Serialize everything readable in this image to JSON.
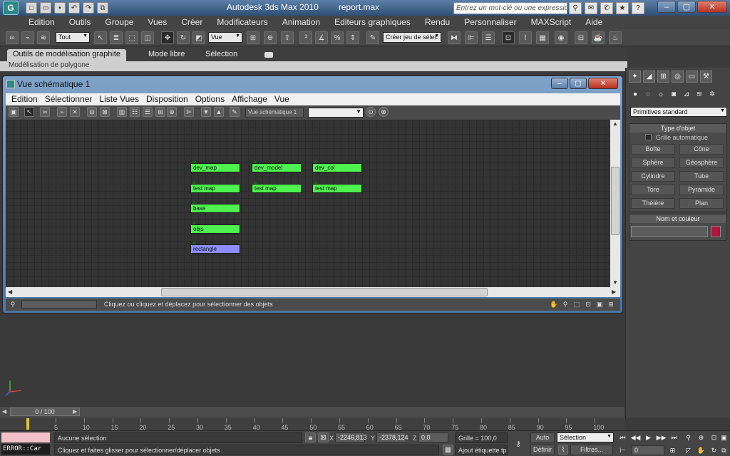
{
  "app": {
    "title": "Autodesk 3ds Max  2010",
    "file": "report.max",
    "icon_letter": "G",
    "search_placeholder": "Entrez un mot-clé ou une expression"
  },
  "menu": [
    "Edition",
    "Outils",
    "Groupe",
    "Vues",
    "Créer",
    "Modificateurs",
    "Animation",
    "Editeurs graphiques",
    "Rendu",
    "Personnaliser",
    "MAXScript",
    "Aide"
  ],
  "toolbar": {
    "filter_select": "Tout",
    "coord_select": "Vue",
    "selection_set": "Créer jeu de sélec"
  },
  "ribbon": {
    "tabs": [
      "Outils de modélisation graphite",
      "Mode libre",
      "Sélection"
    ],
    "sub_label": "Modélisation de polygone"
  },
  "schematic": {
    "title": "Vue schématique 1",
    "menu": [
      "Edition",
      "Sélectionner",
      "Liste Vues",
      "Disposition",
      "Options",
      "Affichage",
      "Vue"
    ],
    "view_name": "Vue schématique 1",
    "status_text": "Cliquez ou cliquez et déplacez pour sélectionner des objets",
    "nodes": [
      {
        "label": "dev_map"
      },
      {
        "label": "dev_model"
      },
      {
        "label": "dev_col"
      },
      {
        "label": "test map"
      },
      {
        "label": "test map"
      },
      {
        "label": "test map"
      },
      {
        "label": "base"
      },
      {
        "label": "objs"
      },
      {
        "label": "rectangle"
      }
    ]
  },
  "command_panel": {
    "category": "Primitives standard",
    "object_type_title": "Type d'objet",
    "autogrid_label": "Grille automatique",
    "buttons": [
      "Boîte",
      "Cône",
      "Sphère",
      "Géosphère",
      "Cylindre",
      "Tube",
      "Tore",
      "Pyramide",
      "Théière",
      "Plan"
    ],
    "name_color_title": "Nom et couleur",
    "swatch_color": "#b0143c"
  },
  "timeline": {
    "frame_label": "0 / 100",
    "ticks": [
      "5",
      "10",
      "15",
      "20",
      "25",
      "30",
      "35",
      "40",
      "45",
      "50",
      "55",
      "60",
      "65",
      "70",
      "75",
      "80",
      "85",
      "90",
      "95",
      "100"
    ]
  },
  "status": {
    "error_text": "ERROR::Car",
    "selection_status": "Aucune sélection",
    "prompt": "Cliquez et faites glisser pour sélectionner/déplacer objets",
    "x_label": "X",
    "x_value": "-2246,813",
    "y_label": "Y",
    "y_value": "-2378,124",
    "z_label": "Z",
    "z_value": "0,0",
    "grid": "Grille = 100,0",
    "add_time_tag": "Ajout étiquette tps",
    "auto_btn": "Auto",
    "set_key_btn": "Définir C.",
    "key_filter_select": "Sélection",
    "filters_btn": "Filtres...",
    "current_frame": "0"
  }
}
